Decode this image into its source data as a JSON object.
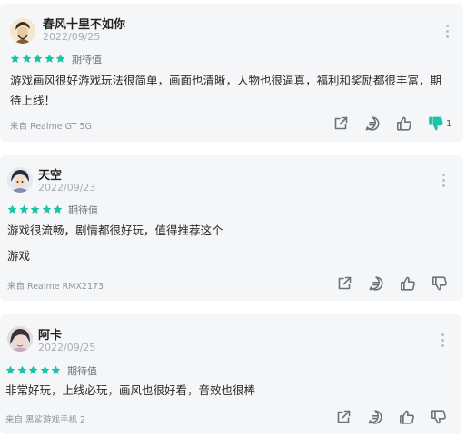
{
  "colors": {
    "accent": "#18c5a8",
    "card_bg": "#f5f6f8",
    "icon_gray": "#6e737b"
  },
  "reviews": [
    {
      "username": "春风十里不如你",
      "date": "2022/09/25",
      "rating": 5,
      "tag": "期待值",
      "text": "游戏画风很好游戏玩法很简单，画面也清晰，人物也很逼真，福利和奖励都很丰富，期待上线！",
      "text_extra": "",
      "device": "来自 Realme GT 5G",
      "dislike_count": "1",
      "dislike_active": true
    },
    {
      "username": "天空",
      "date": "2022/09/23",
      "rating": 5,
      "tag": "期待值",
      "text": "游戏很流畅，剧情都很好玩，值得推荐这个",
      "text_extra": "游戏",
      "device": "来自 Realme RMX2173",
      "dislike_count": "",
      "dislike_active": false
    },
    {
      "username": "阿卡",
      "date": "2022/09/25",
      "rating": 5,
      "tag": "期待值",
      "text": "非常好玩，上线必玩，画风也很好看，音效也很棒",
      "text_extra": "",
      "device": "来自 黑鲨游戏手机 2",
      "dislike_count": "",
      "dislike_active": false
    }
  ],
  "icons": {
    "share": "share-icon",
    "comment": "comment-icon",
    "like": "thumbs-up-icon",
    "dislike": "thumbs-down-icon",
    "more": "more-vertical-icon",
    "star": "star-icon"
  }
}
